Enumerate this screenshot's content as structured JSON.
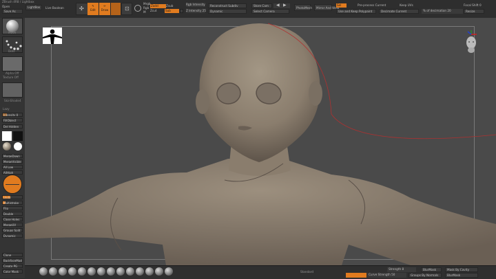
{
  "top": {
    "title": "ZBrush 4R8 / Lightbox",
    "menu_left": "Open",
    "save_as": "Save As",
    "lightbox": "LightBox",
    "live_boolean": "Live Boolean",
    "draw_mode": "Draw",
    "edit_mode": "Edit",
    "move_mode": "Move",
    "mrgb": "Mrgb",
    "rgb": "Rgb",
    "m": "M",
    "zadd": "Zadd",
    "zsub": "Zsub",
    "zcut": "Zcut",
    "rgb_intensity": "Rgb Intensity",
    "z_intensity": "Z Intensity 25",
    "draw_size": "Draw Size 64",
    "focal_shift": "Focal Shift 0",
    "active_points": "ActivePoints: 73,526",
    "total_points": "TotalPoints: 73,526",
    "dynamic": "Dynamic",
    "reconstruct_subdiv": "Reconstruct Subdiv",
    "store_cam": "Store Cam",
    "undo_history": "Undo History",
    "del_higher": "Del Higher",
    "photoshop": "PhotoMesh",
    "mirror_and_weld": "Mirror And Weld",
    "zremesher": "ZRemesher",
    "use_and_keep_polypaint": "Use and Keep Polypaint",
    "decimate_current": "Decimate Current",
    "percent_decimation": "% of decimation 20",
    "preprocess_current": "Pre-process Current",
    "keep_uvs": "Keep UVs",
    "focal_shift_label": "Focal Shift 0",
    "sub_label": "Sub",
    "resize": "Resize",
    "select_camera": "Select Camera"
  },
  "left": {
    "brush_label": "Move",
    "stroke_label": "Dots",
    "alpha_label": "Alpha Off",
    "texture_label": "Texture Off",
    "material_label": "SkinShade4",
    "lazy_mouse": "Lazy",
    "intensity": "Intensity 0",
    "fill_object": "FillObject",
    "del_hidden": "Del Hidden",
    "merge_down": "MergeDown",
    "merge_visible": "MergeVisible",
    "all_low": "All Low",
    "all_high": "AllHigh",
    "undo": "Undo",
    "multistroke": "Multistroke",
    "flip": "Flip",
    "double": "Double",
    "close_holes": "Close Holes",
    "merge_uv": "MergeUV",
    "groups_split": "Groups Split",
    "dynamic": "Dynamic",
    "clone": "Clone",
    "backface_mask": "BackfaceMask",
    "create_pg": "Create PG",
    "color_mask": "Color Mask"
  },
  "bottom": {
    "tools": [
      "Standard",
      "ClayBuildup",
      "DamStandard",
      "Move",
      "Inflate",
      "Pinch",
      "hPolish",
      "Smooth",
      "Move T",
      "Slash3",
      "TrimDynamic",
      "Planar",
      "Layer",
      "ZModeler"
    ],
    "brush_mode": "Standard",
    "strength": "Strength 8",
    "curve_strength": "Curve Strength 50",
    "mask_by_cavity": "Mask By Cavity",
    "blur_mask": "BlurMask",
    "groups_by_normals": "Groups By Normals",
    "blur_mask2": "BlurMask"
  },
  "colors": {
    "accent": "#e07b1f",
    "model": "#8c8072",
    "background": "#4a4a4a"
  }
}
